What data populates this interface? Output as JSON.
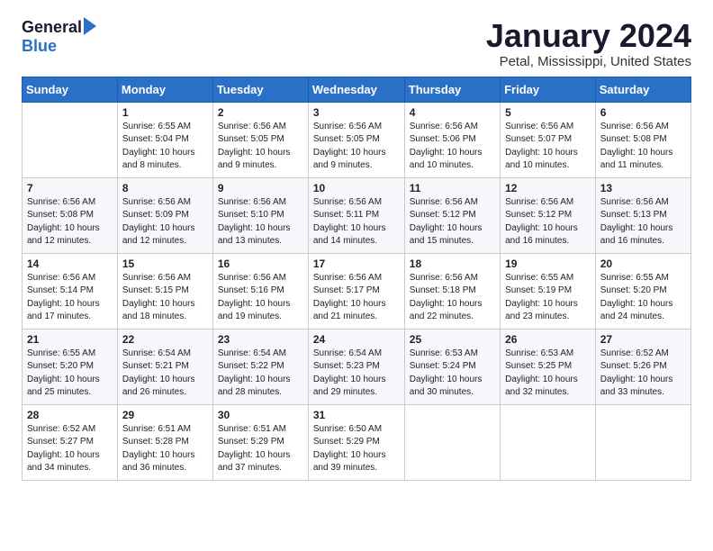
{
  "header": {
    "logo_general": "General",
    "logo_blue": "Blue",
    "month_title": "January 2024",
    "location": "Petal, Mississippi, United States"
  },
  "calendar": {
    "days_of_week": [
      "Sunday",
      "Monday",
      "Tuesday",
      "Wednesday",
      "Thursday",
      "Friday",
      "Saturday"
    ],
    "weeks": [
      [
        {
          "day": "",
          "sunrise": "",
          "sunset": "",
          "daylight": ""
        },
        {
          "day": "1",
          "sunrise": "Sunrise: 6:55 AM",
          "sunset": "Sunset: 5:04 PM",
          "daylight": "Daylight: 10 hours and 8 minutes."
        },
        {
          "day": "2",
          "sunrise": "Sunrise: 6:56 AM",
          "sunset": "Sunset: 5:05 PM",
          "daylight": "Daylight: 10 hours and 9 minutes."
        },
        {
          "day": "3",
          "sunrise": "Sunrise: 6:56 AM",
          "sunset": "Sunset: 5:05 PM",
          "daylight": "Daylight: 10 hours and 9 minutes."
        },
        {
          "day": "4",
          "sunrise": "Sunrise: 6:56 AM",
          "sunset": "Sunset: 5:06 PM",
          "daylight": "Daylight: 10 hours and 10 minutes."
        },
        {
          "day": "5",
          "sunrise": "Sunrise: 6:56 AM",
          "sunset": "Sunset: 5:07 PM",
          "daylight": "Daylight: 10 hours and 10 minutes."
        },
        {
          "day": "6",
          "sunrise": "Sunrise: 6:56 AM",
          "sunset": "Sunset: 5:08 PM",
          "daylight": "Daylight: 10 hours and 11 minutes."
        }
      ],
      [
        {
          "day": "7",
          "sunrise": "Sunrise: 6:56 AM",
          "sunset": "Sunset: 5:08 PM",
          "daylight": "Daylight: 10 hours and 12 minutes."
        },
        {
          "day": "8",
          "sunrise": "Sunrise: 6:56 AM",
          "sunset": "Sunset: 5:09 PM",
          "daylight": "Daylight: 10 hours and 12 minutes."
        },
        {
          "day": "9",
          "sunrise": "Sunrise: 6:56 AM",
          "sunset": "Sunset: 5:10 PM",
          "daylight": "Daylight: 10 hours and 13 minutes."
        },
        {
          "day": "10",
          "sunrise": "Sunrise: 6:56 AM",
          "sunset": "Sunset: 5:11 PM",
          "daylight": "Daylight: 10 hours and 14 minutes."
        },
        {
          "day": "11",
          "sunrise": "Sunrise: 6:56 AM",
          "sunset": "Sunset: 5:12 PM",
          "daylight": "Daylight: 10 hours and 15 minutes."
        },
        {
          "day": "12",
          "sunrise": "Sunrise: 6:56 AM",
          "sunset": "Sunset: 5:12 PM",
          "daylight": "Daylight: 10 hours and 16 minutes."
        },
        {
          "day": "13",
          "sunrise": "Sunrise: 6:56 AM",
          "sunset": "Sunset: 5:13 PM",
          "daylight": "Daylight: 10 hours and 16 minutes."
        }
      ],
      [
        {
          "day": "14",
          "sunrise": "Sunrise: 6:56 AM",
          "sunset": "Sunset: 5:14 PM",
          "daylight": "Daylight: 10 hours and 17 minutes."
        },
        {
          "day": "15",
          "sunrise": "Sunrise: 6:56 AM",
          "sunset": "Sunset: 5:15 PM",
          "daylight": "Daylight: 10 hours and 18 minutes."
        },
        {
          "day": "16",
          "sunrise": "Sunrise: 6:56 AM",
          "sunset": "Sunset: 5:16 PM",
          "daylight": "Daylight: 10 hours and 19 minutes."
        },
        {
          "day": "17",
          "sunrise": "Sunrise: 6:56 AM",
          "sunset": "Sunset: 5:17 PM",
          "daylight": "Daylight: 10 hours and 21 minutes."
        },
        {
          "day": "18",
          "sunrise": "Sunrise: 6:56 AM",
          "sunset": "Sunset: 5:18 PM",
          "daylight": "Daylight: 10 hours and 22 minutes."
        },
        {
          "day": "19",
          "sunrise": "Sunrise: 6:55 AM",
          "sunset": "Sunset: 5:19 PM",
          "daylight": "Daylight: 10 hours and 23 minutes."
        },
        {
          "day": "20",
          "sunrise": "Sunrise: 6:55 AM",
          "sunset": "Sunset: 5:20 PM",
          "daylight": "Daylight: 10 hours and 24 minutes."
        }
      ],
      [
        {
          "day": "21",
          "sunrise": "Sunrise: 6:55 AM",
          "sunset": "Sunset: 5:20 PM",
          "daylight": "Daylight: 10 hours and 25 minutes."
        },
        {
          "day": "22",
          "sunrise": "Sunrise: 6:54 AM",
          "sunset": "Sunset: 5:21 PM",
          "daylight": "Daylight: 10 hours and 26 minutes."
        },
        {
          "day": "23",
          "sunrise": "Sunrise: 6:54 AM",
          "sunset": "Sunset: 5:22 PM",
          "daylight": "Daylight: 10 hours and 28 minutes."
        },
        {
          "day": "24",
          "sunrise": "Sunrise: 6:54 AM",
          "sunset": "Sunset: 5:23 PM",
          "daylight": "Daylight: 10 hours and 29 minutes."
        },
        {
          "day": "25",
          "sunrise": "Sunrise: 6:53 AM",
          "sunset": "Sunset: 5:24 PM",
          "daylight": "Daylight: 10 hours and 30 minutes."
        },
        {
          "day": "26",
          "sunrise": "Sunrise: 6:53 AM",
          "sunset": "Sunset: 5:25 PM",
          "daylight": "Daylight: 10 hours and 32 minutes."
        },
        {
          "day": "27",
          "sunrise": "Sunrise: 6:52 AM",
          "sunset": "Sunset: 5:26 PM",
          "daylight": "Daylight: 10 hours and 33 minutes."
        }
      ],
      [
        {
          "day": "28",
          "sunrise": "Sunrise: 6:52 AM",
          "sunset": "Sunset: 5:27 PM",
          "daylight": "Daylight: 10 hours and 34 minutes."
        },
        {
          "day": "29",
          "sunrise": "Sunrise: 6:51 AM",
          "sunset": "Sunset: 5:28 PM",
          "daylight": "Daylight: 10 hours and 36 minutes."
        },
        {
          "day": "30",
          "sunrise": "Sunrise: 6:51 AM",
          "sunset": "Sunset: 5:29 PM",
          "daylight": "Daylight: 10 hours and 37 minutes."
        },
        {
          "day": "31",
          "sunrise": "Sunrise: 6:50 AM",
          "sunset": "Sunset: 5:29 PM",
          "daylight": "Daylight: 10 hours and 39 minutes."
        },
        {
          "day": "",
          "sunrise": "",
          "sunset": "",
          "daylight": ""
        },
        {
          "day": "",
          "sunrise": "",
          "sunset": "",
          "daylight": ""
        },
        {
          "day": "",
          "sunrise": "",
          "sunset": "",
          "daylight": ""
        }
      ]
    ]
  }
}
